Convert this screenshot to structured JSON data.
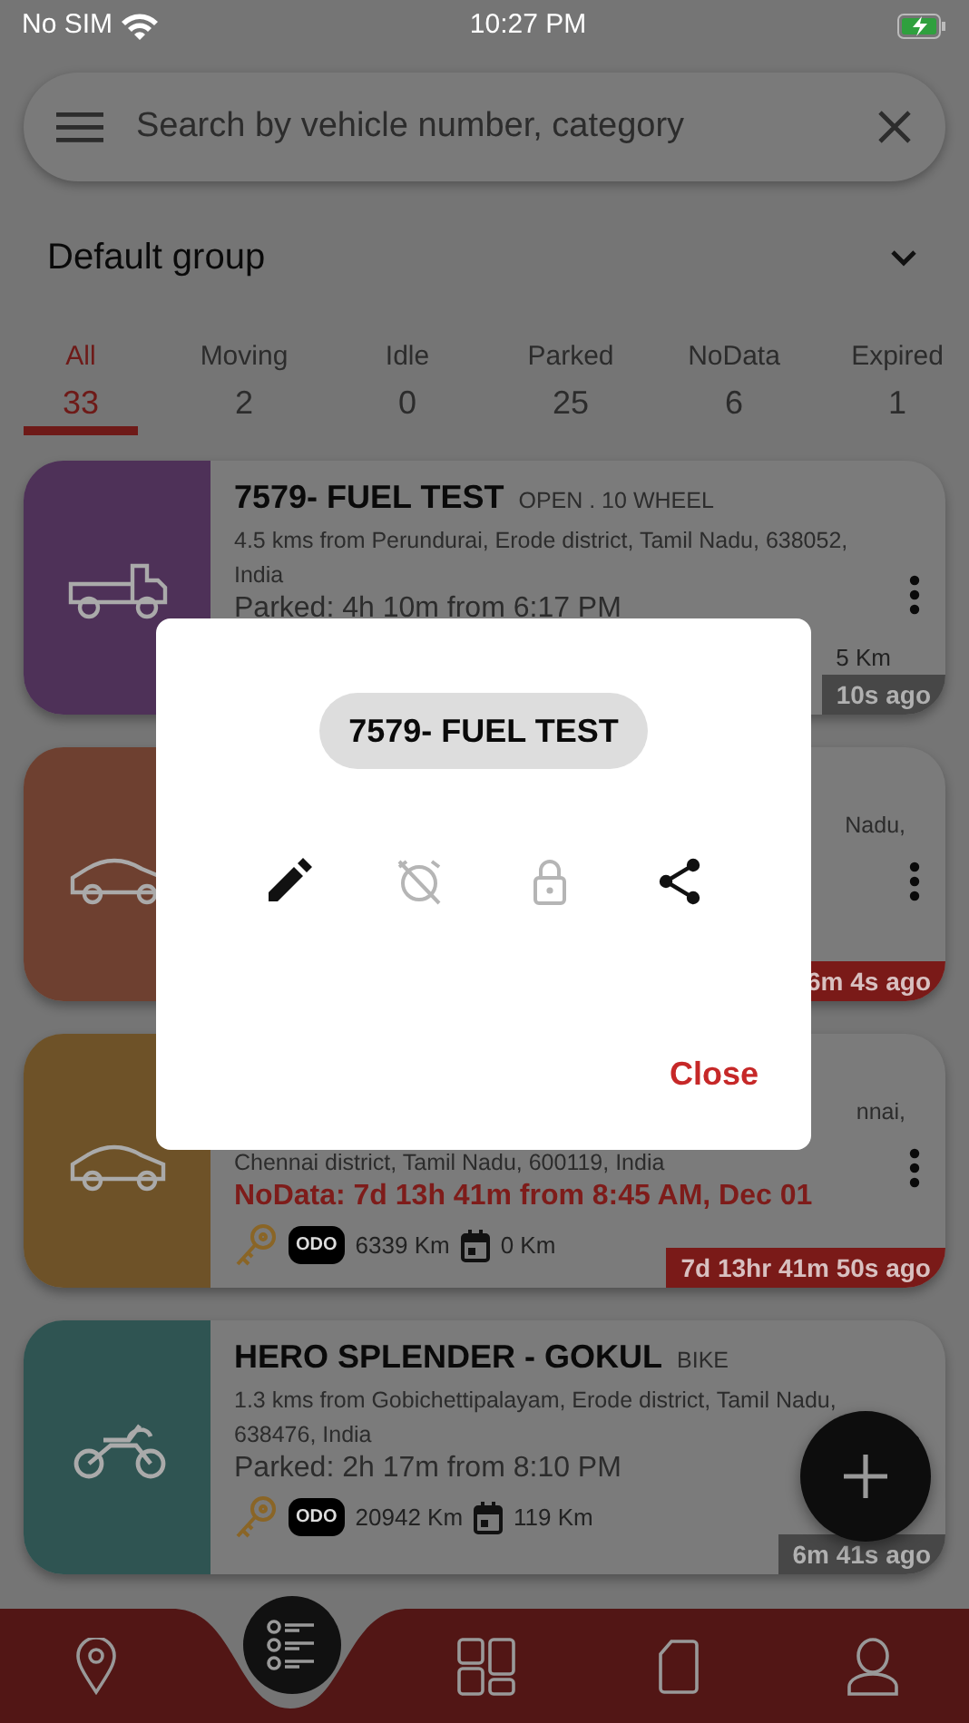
{
  "status_bar": {
    "carrier": "No SIM",
    "time": "10:27 PM"
  },
  "search": {
    "placeholder": "Search by vehicle number, category"
  },
  "group": {
    "label": "Default group"
  },
  "tabs": [
    {
      "label": "All",
      "count": "33",
      "selected": true
    },
    {
      "label": "Moving",
      "count": "2",
      "selected": false
    },
    {
      "label": "Idle",
      "count": "0",
      "selected": false
    },
    {
      "label": "Parked",
      "count": "25",
      "selected": false
    },
    {
      "label": "NoData",
      "count": "6",
      "selected": false
    },
    {
      "label": "Expired",
      "count": "1",
      "selected": false
    }
  ],
  "vehicles": [
    {
      "kind": "truck",
      "color": "#4e3158",
      "no_data": false,
      "title": "7579- FUEL TEST",
      "type": "OPEN . 10 WHEEL",
      "address": [
        "4.5 kms from Perundurai, Erode district, Tamil Nadu, 638052,",
        "India"
      ],
      "status_text": "Parked: 4h 10m from 6:17 PM",
      "trip": "5 Km",
      "time_ago": "10s  ago"
    },
    {
      "kind": "car",
      "color": "#6e4030",
      "no_data": true,
      "address": [
        "Nadu,"
      ],
      "time_ago": "6m 4s  ago"
    },
    {
      "kind": "car",
      "color": "#6e5228",
      "no_data": true,
      "address": [
        "nnai,",
        "Chennai district, Tamil Nadu, 600119, India"
      ],
      "status_text": "NoData:  7d 13h 41m from 8:45 AM, Dec 01",
      "odo_badge": "ODO",
      "odometer": "6339 Km",
      "trip": "0 Km",
      "time_ago": "7d 13hr 41m 50s  ago"
    },
    {
      "kind": "bike",
      "color": "#2f5452",
      "no_data": false,
      "title": "HERO SPLENDER - GOKUL",
      "type": "BIKE",
      "address": [
        "1.3 kms from Gobichettipalayam, Erode district, Tamil Nadu,",
        "638476, India"
      ],
      "status_text": "Parked: 2h 17m from 8:10 PM",
      "odo_badge": "ODO",
      "odometer": "20942 Km",
      "trip": "119 Km",
      "time_ago": "6m 41s  ago"
    }
  ],
  "nav": [
    {
      "kind": "map",
      "selected": false
    },
    {
      "kind": "list",
      "selected": true
    },
    {
      "kind": "dashboard",
      "selected": false
    },
    {
      "kind": "document",
      "selected": false
    },
    {
      "kind": "profile",
      "selected": false
    }
  ],
  "dialog": {
    "title": "7579- FUEL TEST",
    "actions": [
      {
        "kind": "edit",
        "disabled": false
      },
      {
        "kind": "alarm",
        "disabled": true
      },
      {
        "kind": "lock",
        "disabled": true
      },
      {
        "kind": "share",
        "disabled": false
      }
    ],
    "close": "Close"
  }
}
